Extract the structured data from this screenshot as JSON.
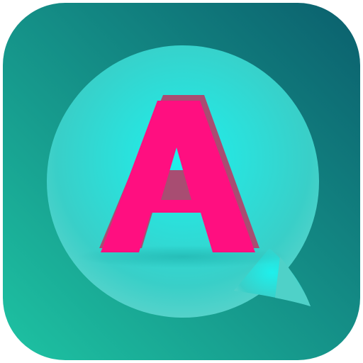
{
  "icon": {
    "glyph": "A",
    "background_gradient": [
      "#1ec3a3",
      "#0b5f6d"
    ],
    "bubble_gradient": [
      "#1ef0ec",
      "#39cfc8",
      "#5ed4cb"
    ],
    "letter_color": "#ff0f80",
    "letter_shadow_color": "#a84d72"
  }
}
